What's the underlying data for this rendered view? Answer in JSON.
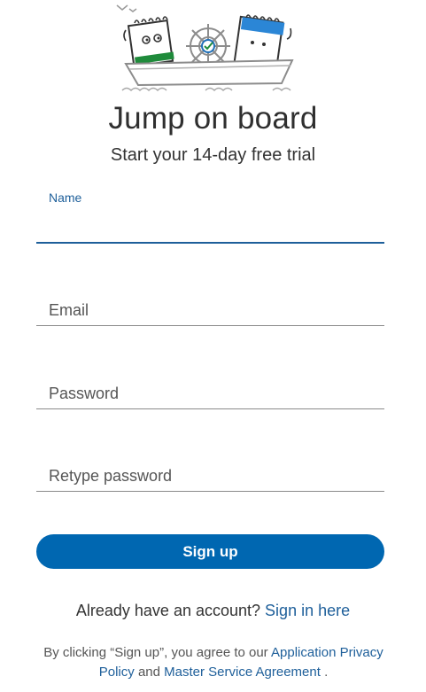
{
  "header": {
    "title": "Jump on board",
    "subtitle": "Start your 14-day free trial"
  },
  "form": {
    "name": {
      "label": "Name",
      "value": ""
    },
    "email": {
      "placeholder": "Email",
      "value": ""
    },
    "password": {
      "placeholder": "Password",
      "value": ""
    },
    "retype_password": {
      "placeholder": "Retype password",
      "value": ""
    },
    "submit_label": "Sign up"
  },
  "signin": {
    "prompt": "Already have an account?",
    "link_label": "Sign in here"
  },
  "terms": {
    "prefix": "By clicking “Sign up”, you agree to our",
    "privacy_link": "Application Privacy Policy",
    "conjunction": "and",
    "msa_link": "Master Service Agreement",
    "suffix": "."
  },
  "colors": {
    "accent": "#0067b1",
    "link": "#1e5f9a",
    "title": "#2f2f2f",
    "green_notebook": "#1f8b3b",
    "blue_notebook": "#2b86d6"
  },
  "icons": {
    "illustration": "boat-with-notebook-characters"
  }
}
